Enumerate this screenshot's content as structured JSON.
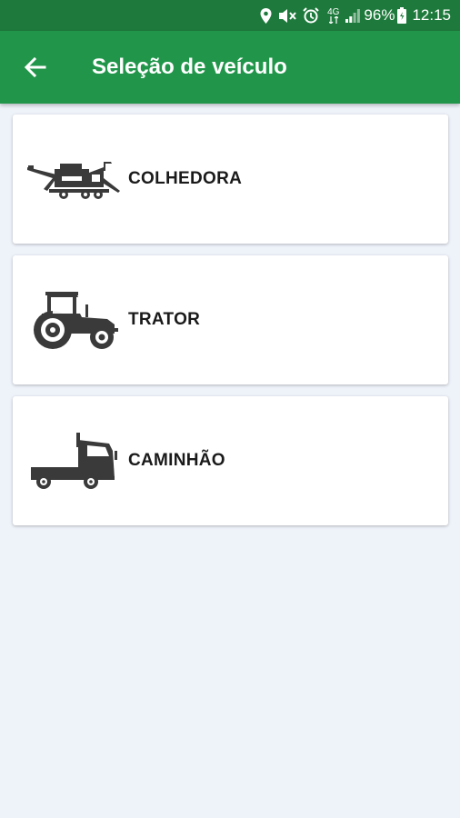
{
  "status_bar": {
    "battery_percent": "96%",
    "time": "12:15",
    "network_label": "4G",
    "icons": [
      "location-icon",
      "mute-icon",
      "alarm-icon",
      "network-icon",
      "signal-icon",
      "battery-icon"
    ]
  },
  "app_bar": {
    "back_icon": "arrow-left-icon",
    "title": "Seleção de veículo"
  },
  "vehicles": [
    {
      "label": "COLHEDORA",
      "icon": "harvester-icon"
    },
    {
      "label": "TRATOR",
      "icon": "tractor-icon"
    },
    {
      "label": "CAMINHÃO",
      "icon": "truck-icon"
    }
  ],
  "colors": {
    "status_bar": "#1e7a3c",
    "app_bar": "#21964b",
    "background": "#eef2f9",
    "icon": "#3a3a3a"
  }
}
